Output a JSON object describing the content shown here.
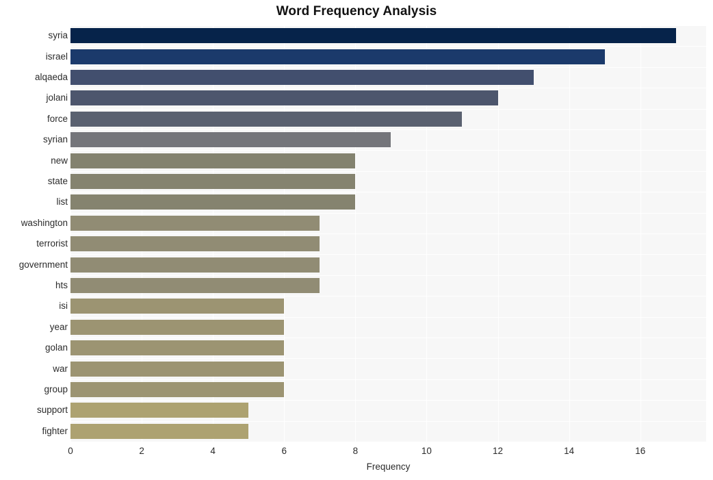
{
  "chart_data": {
    "type": "bar",
    "orientation": "horizontal",
    "title": "Word Frequency Analysis",
    "xlabel": "Frequency",
    "ylabel": "",
    "categories": [
      "syria",
      "israel",
      "alqaeda",
      "jolani",
      "force",
      "syrian",
      "new",
      "state",
      "list",
      "washington",
      "terrorist",
      "government",
      "hts",
      "isi",
      "year",
      "golan",
      "war",
      "group",
      "support",
      "fighter"
    ],
    "values": [
      17,
      15,
      13,
      12,
      11,
      9,
      8,
      8,
      8,
      7,
      7,
      7,
      7,
      6,
      6,
      6,
      6,
      6,
      5,
      5
    ],
    "bar_colors": [
      "#06234a",
      "#1b3a6b",
      "#424f6e",
      "#4d566d",
      "#5a6170",
      "#74757a",
      "#83826f",
      "#85836f",
      "#85836f",
      "#918c74",
      "#918c74",
      "#918c74",
      "#918c74",
      "#9c9472",
      "#9c9472",
      "#9c9472",
      "#9c9472",
      "#9c9472",
      "#ada271",
      "#ada271"
    ],
    "xticks": [
      0,
      2,
      4,
      6,
      8,
      10,
      12,
      14,
      16
    ],
    "xlim": [
      0,
      17.85
    ],
    "grid": true,
    "grid_color": "#ffffff",
    "plot_background": "#f7f7f7",
    "figure_background": "#ffffff",
    "legend": null
  },
  "style": {
    "title_color": "#111111",
    "tick_color": "#2b2b2b"
  }
}
